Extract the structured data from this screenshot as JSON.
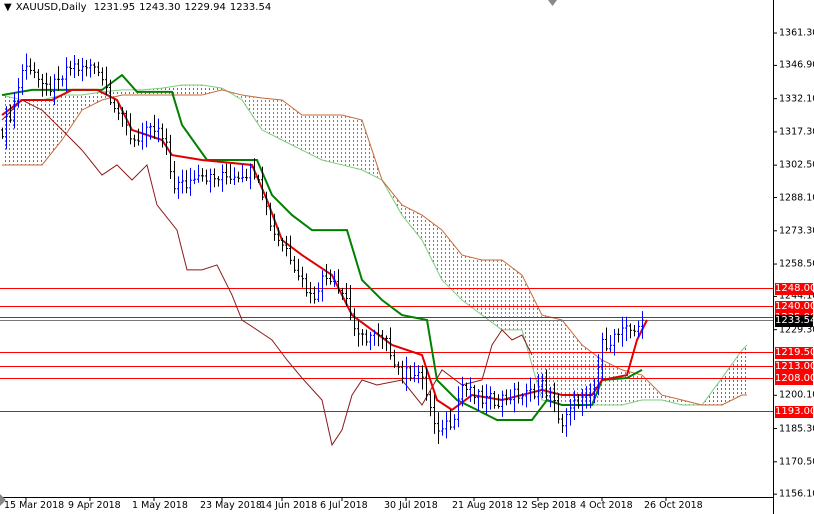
{
  "header": {
    "symbol": "XAUUSD,Daily",
    "open": "1231.95",
    "high": "1243.30",
    "low": "1229.94",
    "close": "1233.54"
  },
  "colors": {
    "up": "#0000ff",
    "down": "#000000",
    "tenkan": "#e00000",
    "kijun": "#008000",
    "chikou": "#8b1a1a",
    "cloud_bull": "#22aa22",
    "cloud_bear": "#ff5500",
    "level": "#ff0000"
  },
  "price_axis": {
    "min": 1156.1,
    "max": 1361.3,
    "ticks": [
      "1361.30",
      "1346.90",
      "1332.10",
      "1317.30",
      "1302.50",
      "1288.10",
      "1273.30",
      "1258.50",
      "1244.10",
      "1229.30",
      "1200.10",
      "1185.30",
      "1170.50",
      "1156.10"
    ]
  },
  "levels": [
    {
      "price": 1248.0,
      "label": "1248.00"
    },
    {
      "price": 1240.0,
      "label": "1240.00"
    },
    {
      "price": 1235.0,
      "label": "1235.00"
    },
    {
      "price": 1219.5,
      "label": "1219.50"
    },
    {
      "price": 1213.0,
      "label": "1213.00"
    },
    {
      "price": 1208.0,
      "label": "1208.00"
    },
    {
      "price": 1193.0,
      "label": "1193.00"
    }
  ],
  "current_price": {
    "price": 1233.54,
    "label": "1233.54"
  },
  "time_axis": [
    {
      "bar": 6,
      "label": "15 Mar 2018"
    },
    {
      "bar": 22,
      "label": "9 Apr 2018"
    },
    {
      "bar": 38,
      "label": "1 May 2018"
    },
    {
      "bar": 55,
      "label": "23 May 2018"
    },
    {
      "bar": 70,
      "label": "14 Jun 2018"
    },
    {
      "bar": 85,
      "label": "6 Jul 2018"
    },
    {
      "bar": 101,
      "label": "30 Jul 2018"
    },
    {
      "bar": 118,
      "label": "21 Aug 2018"
    },
    {
      "bar": 134,
      "label": "12 Sep 2018"
    },
    {
      "bar": 150,
      "label": "4 Oct 2018"
    },
    {
      "bar": 166,
      "label": "26 Oct 2018"
    }
  ],
  "chart_data": {
    "type": "line",
    "title": "XAUUSD,Daily",
    "bars_total": 193,
    "close": [
      [
        0,
        1318.2
      ],
      [
        2.5,
        1327.0
      ],
      [
        5,
        1344.9
      ],
      [
        7.5,
        1347.1
      ],
      [
        10,
        1336.0
      ],
      [
        13.75,
        1338.2
      ],
      [
        17.5,
        1347.1
      ],
      [
        20,
        1344.9
      ],
      [
        23.75,
        1347.1
      ],
      [
        26.25,
        1336.0
      ],
      [
        28.75,
        1327.0
      ],
      [
        32.5,
        1313.7
      ],
      [
        35,
        1315.9
      ],
      [
        38.75,
        1318.2
      ],
      [
        41.25,
        1309.2
      ],
      [
        42.5,
        1293.7
      ],
      [
        46.25,
        1293.7
      ],
      [
        48.75,
        1300.4
      ],
      [
        52.5,
        1295.9
      ],
      [
        57.5,
        1298.1
      ],
      [
        63.75,
        1300.4
      ],
      [
        65.5,
        1287.0
      ],
      [
        67.5,
        1273.6
      ],
      [
        71.25,
        1264.8
      ],
      [
        75,
        1251.4
      ],
      [
        77.5,
        1242.5
      ],
      [
        79.5,
        1251.4
      ],
      [
        82.5,
        1253.6
      ],
      [
        86.25,
        1242.5
      ],
      [
        88.75,
        1224.7
      ],
      [
        92.5,
        1226.9
      ],
      [
        96.25,
        1222.5
      ],
      [
        100,
        1209.1
      ],
      [
        103.75,
        1211.4
      ],
      [
        106.25,
        1200.2
      ],
      [
        108.75,
        1180.2
      ],
      [
        110,
        1186.9
      ],
      [
        112.5,
        1189.1
      ],
      [
        115,
        1204.7
      ],
      [
        117.5,
        1200.2
      ],
      [
        120,
        1198.0
      ],
      [
        123.75,
        1198.0
      ],
      [
        127.5,
        1200.2
      ],
      [
        131.25,
        1200.2
      ],
      [
        135,
        1204.7
      ],
      [
        137.5,
        1198.0
      ],
      [
        140,
        1186.9
      ],
      [
        143.75,
        1198.0
      ],
      [
        147.5,
        1198.0
      ],
      [
        150,
        1222.5
      ],
      [
        153.75,
        1226.9
      ],
      [
        157.5,
        1229.2
      ],
      [
        160,
        1233.5
      ]
    ],
    "tenkan": [
      [
        0,
        1324.8
      ],
      [
        5,
        1331.5
      ],
      [
        12.5,
        1331.5
      ],
      [
        17.5,
        1336.0
      ],
      [
        23.75,
        1336.0
      ],
      [
        28.75,
        1331.5
      ],
      [
        32.5,
        1318.2
      ],
      [
        40,
        1313.7
      ],
      [
        42.5,
        1307.0
      ],
      [
        50,
        1304.8
      ],
      [
        62.5,
        1302.6
      ],
      [
        66.25,
        1287.0
      ],
      [
        70,
        1269.2
      ],
      [
        75,
        1262.5
      ],
      [
        82.5,
        1253.6
      ],
      [
        87.5,
        1235.8
      ],
      [
        92.5,
        1229.2
      ],
      [
        97.5,
        1222.5
      ],
      [
        105,
        1218.0
      ],
      [
        108.75,
        1198.0
      ],
      [
        112.5,
        1193.6
      ],
      [
        117.5,
        1200.2
      ],
      [
        125,
        1198.0
      ],
      [
        135,
        1202.5
      ],
      [
        140,
        1200.2
      ],
      [
        147.5,
        1200.2
      ],
      [
        150,
        1206.9
      ],
      [
        156.25,
        1209.1
      ],
      [
        158.75,
        1224.7
      ],
      [
        161.25,
        1233.6
      ]
    ],
    "kijun": [
      [
        0,
        1333.7
      ],
      [
        7.5,
        1336.0
      ],
      [
        25,
        1336.0
      ],
      [
        30,
        1342.6
      ],
      [
        33.75,
        1335.1
      ],
      [
        42.5,
        1335.1
      ],
      [
        45,
        1320.4
      ],
      [
        51.25,
        1304.8
      ],
      [
        63.75,
        1304.8
      ],
      [
        67.5,
        1289.2
      ],
      [
        72.5,
        1280.3
      ],
      [
        77.5,
        1273.6
      ],
      [
        86.25,
        1273.6
      ],
      [
        90,
        1251.4
      ],
      [
        95,
        1242.5
      ],
      [
        100,
        1235.8
      ],
      [
        106.25,
        1233.6
      ],
      [
        108.75,
        1206.9
      ],
      [
        113.75,
        1198.0
      ],
      [
        118.75,
        1193.6
      ],
      [
        123.75,
        1189.1
      ],
      [
        132.5,
        1189.1
      ],
      [
        136.25,
        1198.0
      ],
      [
        140,
        1195.8
      ],
      [
        147.5,
        1195.8
      ],
      [
        150,
        1206.9
      ],
      [
        156.25,
        1207.8
      ],
      [
        160,
        1211.4
      ]
    ],
    "chikou": [
      [
        0,
        1322.6
      ],
      [
        5,
        1331.5
      ],
      [
        10,
        1327.0
      ],
      [
        15,
        1318.2
      ],
      [
        20,
        1309.2
      ],
      [
        25,
        1298.1
      ],
      [
        28.75,
        1302.6
      ],
      [
        32.5,
        1295.9
      ],
      [
        36.25,
        1302.6
      ],
      [
        38.75,
        1284.8
      ],
      [
        43.75,
        1273.6
      ],
      [
        46.25,
        1255.9
      ],
      [
        50,
        1255.9
      ],
      [
        53.75,
        1258.1
      ],
      [
        57.5,
        1244.7
      ],
      [
        60,
        1233.6
      ],
      [
        63.75,
        1229.2
      ],
      [
        67.5,
        1224.7
      ],
      [
        71.25,
        1215.8
      ],
      [
        75,
        1207.8
      ],
      [
        80,
        1198.0
      ],
      [
        82.5,
        1178.0
      ],
      [
        85,
        1184.7
      ],
      [
        87.5,
        1200.2
      ],
      [
        90,
        1206.9
      ],
      [
        93.75,
        1204.7
      ],
      [
        100,
        1206.9
      ],
      [
        105,
        1195.8
      ],
      [
        110,
        1211.4
      ],
      [
        115,
        1204.7
      ],
      [
        120,
        1206.9
      ],
      [
        122.5,
        1222.5
      ],
      [
        125,
        1229.2
      ],
      [
        127.5,
        1224.7
      ],
      [
        130,
        1226.9
      ],
      [
        132.5,
        1218.0
      ]
    ],
    "span_a": [
      [
        0,
        1333.7
      ],
      [
        5,
        1331.5
      ],
      [
        10,
        1331.5
      ],
      [
        15,
        1333.7
      ],
      [
        20,
        1333.7
      ],
      [
        25,
        1335.1
      ],
      [
        30,
        1336.0
      ],
      [
        35,
        1336.0
      ],
      [
        40,
        1336.8
      ],
      [
        45,
        1338.2
      ],
      [
        50,
        1338.2
      ],
      [
        55,
        1336.8
      ],
      [
        60,
        1331.5
      ],
      [
        65,
        1318.2
      ],
      [
        70,
        1313.7
      ],
      [
        75,
        1309.2
      ],
      [
        80,
        1304.8
      ],
      [
        85,
        1302.6
      ],
      [
        90,
        1300.4
      ],
      [
        95,
        1295.9
      ],
      [
        100,
        1280.3
      ],
      [
        105,
        1269.2
      ],
      [
        110,
        1251.4
      ],
      [
        115,
        1242.5
      ],
      [
        120,
        1235.8
      ],
      [
        125,
        1229.2
      ],
      [
        130,
        1229.2
      ],
      [
        135,
        1198.0
      ],
      [
        140,
        1195.8
      ],
      [
        145,
        1195.8
      ],
      [
        150,
        1195.8
      ],
      [
        155,
        1195.8
      ],
      [
        160,
        1198.0
      ],
      [
        165,
        1198.0
      ],
      [
        170,
        1195.8
      ],
      [
        175,
        1195.8
      ],
      [
        180,
        1207.8
      ],
      [
        185,
        1220.2
      ],
      [
        186.25,
        1222.5
      ]
    ],
    "span_b": [
      [
        0,
        1302.6
      ],
      [
        5,
        1302.6
      ],
      [
        10,
        1302.6
      ],
      [
        15,
        1313.7
      ],
      [
        20,
        1327.0
      ],
      [
        25,
        1331.5
      ],
      [
        30,
        1333.7
      ],
      [
        35,
        1333.7
      ],
      [
        40,
        1333.7
      ],
      [
        45,
        1333.7
      ],
      [
        50,
        1333.7
      ],
      [
        55,
        1336.0
      ],
      [
        60,
        1333.7
      ],
      [
        65,
        1332.4
      ],
      [
        70,
        1331.5
      ],
      [
        75,
        1324.8
      ],
      [
        80,
        1324.8
      ],
      [
        85,
        1324.8
      ],
      [
        90,
        1322.6
      ],
      [
        95,
        1295.9
      ],
      [
        100,
        1284.8
      ],
      [
        105,
        1280.3
      ],
      [
        110,
        1273.6
      ],
      [
        115,
        1262.5
      ],
      [
        120,
        1260.3
      ],
      [
        125,
        1260.3
      ],
      [
        130,
        1253.6
      ],
      [
        135,
        1235.8
      ],
      [
        140,
        1233.6
      ],
      [
        145,
        1222.5
      ],
      [
        150,
        1215.8
      ],
      [
        155,
        1211.4
      ],
      [
        160,
        1209.1
      ],
      [
        165,
        1200.2
      ],
      [
        170,
        1198.0
      ],
      [
        175,
        1195.8
      ],
      [
        180,
        1195.8
      ],
      [
        185,
        1200.2
      ],
      [
        186.25,
        1200.2
      ]
    ]
  }
}
